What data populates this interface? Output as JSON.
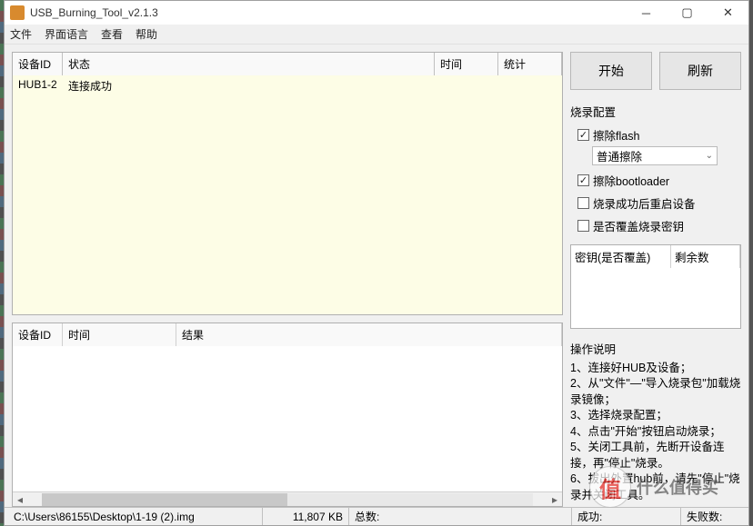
{
  "title": "USB_Burning_Tool_v2.1.3",
  "menu": [
    "文件",
    "界面语言",
    "查看",
    "帮助"
  ],
  "deviceTable": {
    "headers": {
      "id": "设备ID",
      "status": "状态",
      "time": "时间",
      "stats": "统计"
    },
    "rows": [
      {
        "id": "HUB1-2",
        "status": "连接成功",
        "time": "",
        "stats": ""
      }
    ]
  },
  "logTable": {
    "headers": {
      "id": "设备ID",
      "time": "时间",
      "result": "结果"
    }
  },
  "buttons": {
    "start": "开始",
    "refresh": "刷新"
  },
  "config": {
    "title": "烧录配置",
    "eraseFlash": "擦除flash",
    "eraseMode": "普通擦除",
    "eraseBootloader": "擦除bootloader",
    "restartAfter": "烧录成功后重启设备",
    "overwriteKey": "是否覆盖烧录密钥"
  },
  "keyTable": {
    "col1": "密钥(是否覆盖)",
    "col2": "剩余数"
  },
  "instructions": {
    "title": "操作说明",
    "lines": [
      "1、连接好HUB及设备；",
      "2、从\"文件\"—\"导入烧录包\"加载烧录镜像；",
      "3、选择烧录配置；",
      "4、点击\"开始\"按钮启动烧录；",
      "5、关闭工具前，先断开设备连接，再\"停止\"烧录。",
      "6、拔出外置hub前，请先\"停止\"烧录并关闭工具。"
    ]
  },
  "statusbar": {
    "path": "C:\\Users\\86155\\Desktop\\1-19 (2).img",
    "size": "11,807 KB",
    "totalLabel": "总数:",
    "successLabel": "成功:",
    "failLabel": "失败数:"
  },
  "watermark": {
    "char": "值",
    "text": "什么值得买"
  }
}
